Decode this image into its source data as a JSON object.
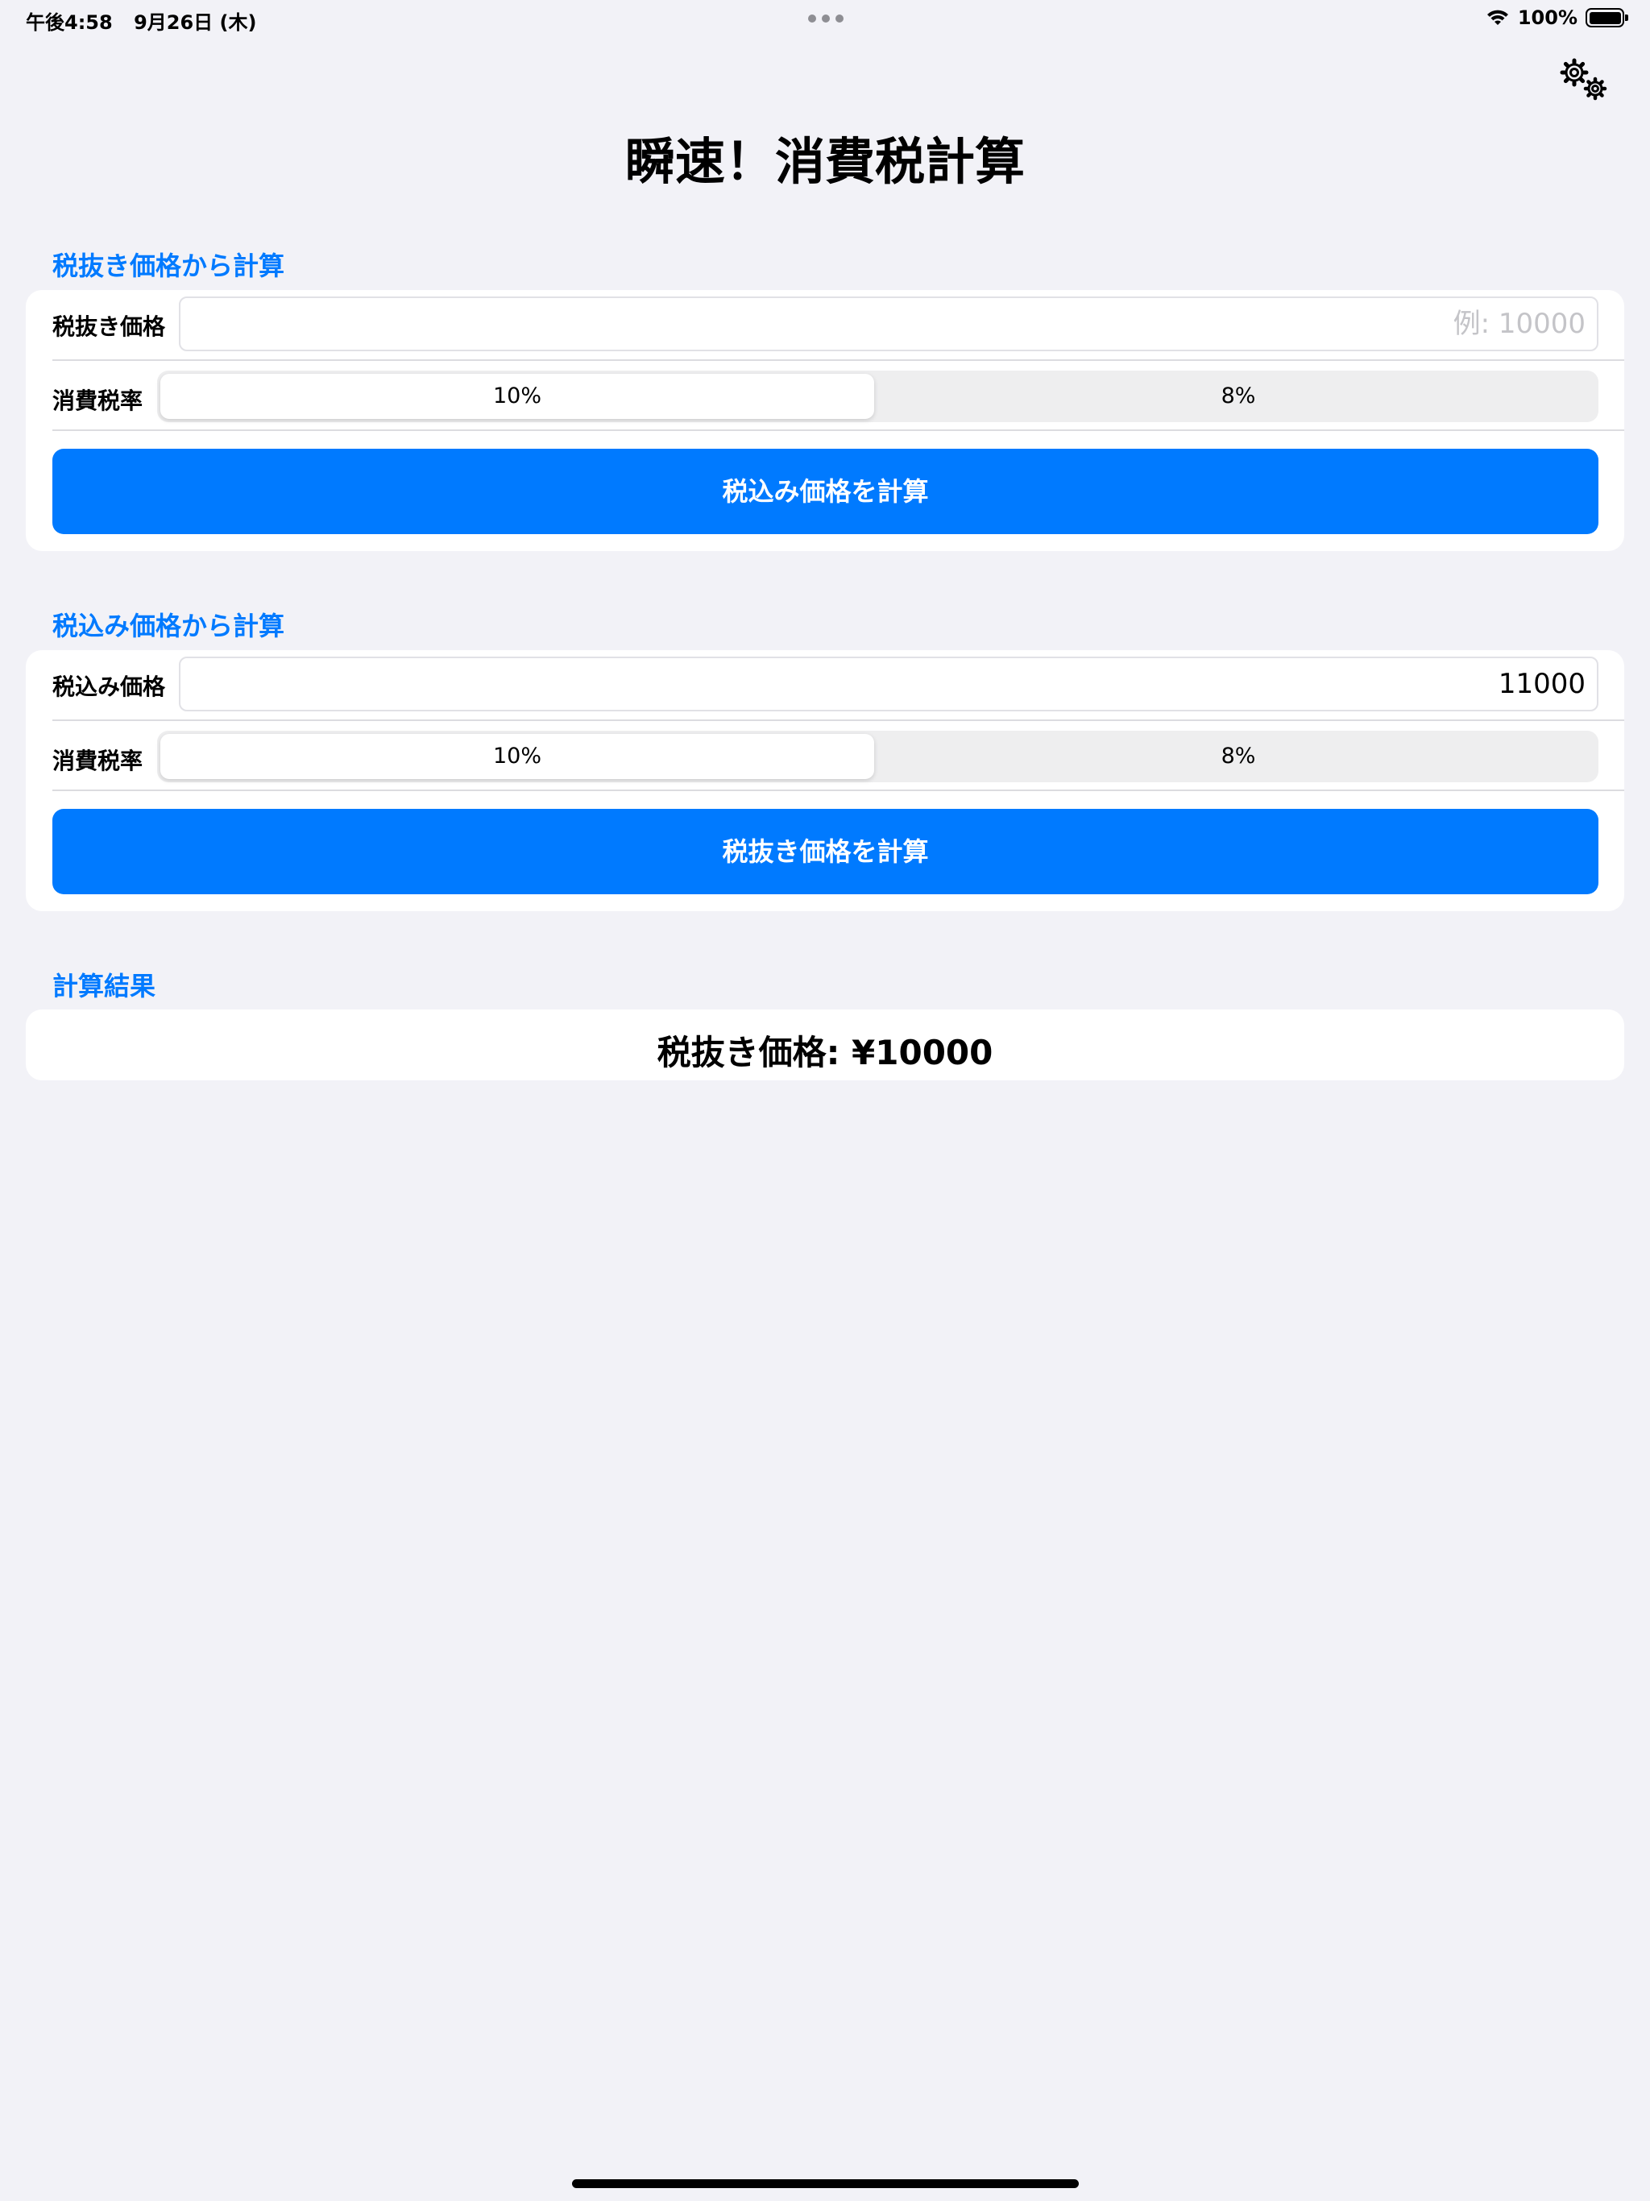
{
  "status_bar": {
    "time": "午後4:58",
    "date": "9月26日 (木)",
    "battery": "100%"
  },
  "page": {
    "title": "瞬速！消費税計算"
  },
  "section_exclusive": {
    "header": "税抜き価格から計算",
    "price_label": "税抜き価格",
    "price_value": "",
    "price_placeholder": "例: 10000",
    "rate_label": "消費税率",
    "rate_options": [
      "10%",
      "8%"
    ],
    "rate_selected": "10%",
    "button": "税込み価格を計算"
  },
  "section_inclusive": {
    "header": "税込み価格から計算",
    "price_label": "税込み価格",
    "price_value": "11000",
    "rate_label": "消費税率",
    "rate_options": [
      "10%",
      "8%"
    ],
    "rate_selected": "10%",
    "button": "税抜き価格を計算"
  },
  "result": {
    "header": "計算結果",
    "text": "税抜き価格: ¥10000"
  },
  "colors": {
    "accent": "#007aff",
    "background": "#f2f2f7",
    "card": "#ffffff"
  },
  "icons": {
    "settings": "gears-icon",
    "wifi": "wifi-icon",
    "battery": "battery-icon"
  }
}
